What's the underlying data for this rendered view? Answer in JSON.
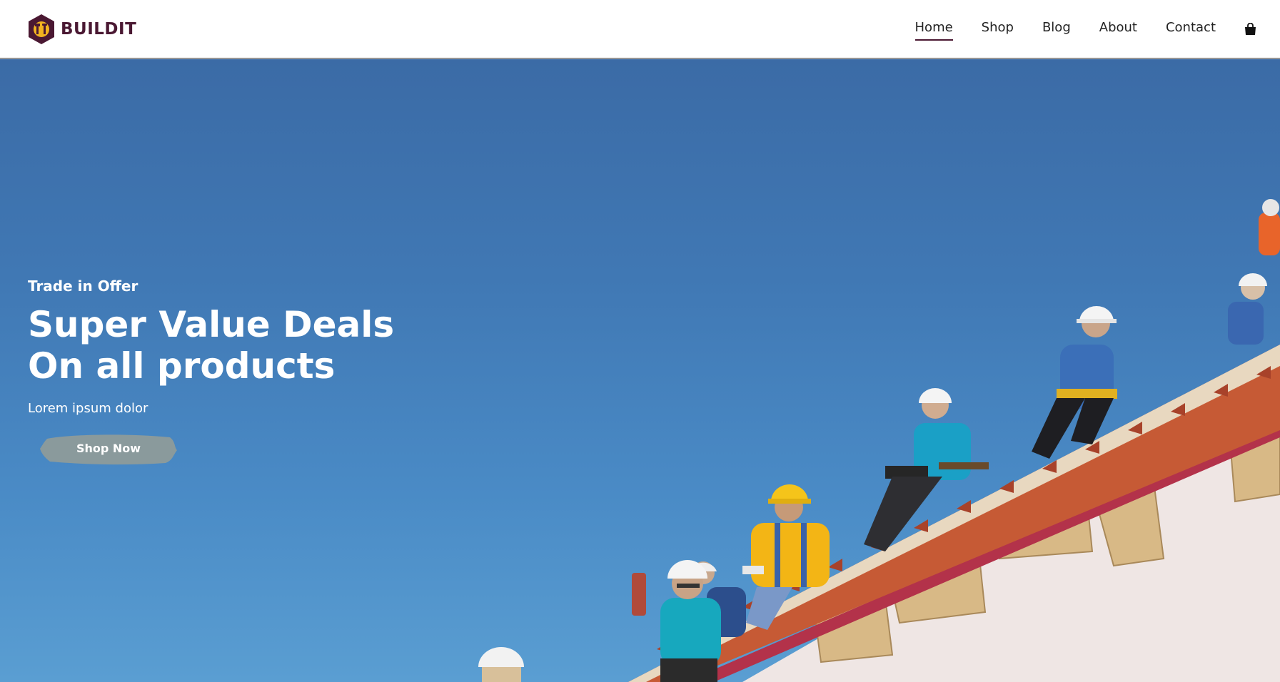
{
  "brand": {
    "name": "BUILDIT",
    "logo_icon": "hex-tools-icon",
    "color": "#4a1832",
    "accent": "#f2b320"
  },
  "nav": {
    "items": [
      {
        "label": "Home",
        "active": true
      },
      {
        "label": "Shop",
        "active": false
      },
      {
        "label": "Blog",
        "active": false
      },
      {
        "label": "About",
        "active": false
      },
      {
        "label": "Contact",
        "active": false
      }
    ],
    "cart_icon": "shopping-bag-icon"
  },
  "hero": {
    "eyebrow": "Trade in Offer",
    "title_line1": "Super Value Deals",
    "title_line2": "On all products",
    "subtitle": "Lorem ipsum dolor",
    "cta_label": "Shop Now",
    "cta_color": "#8a9a9c",
    "sky_color": "#4078b4"
  }
}
